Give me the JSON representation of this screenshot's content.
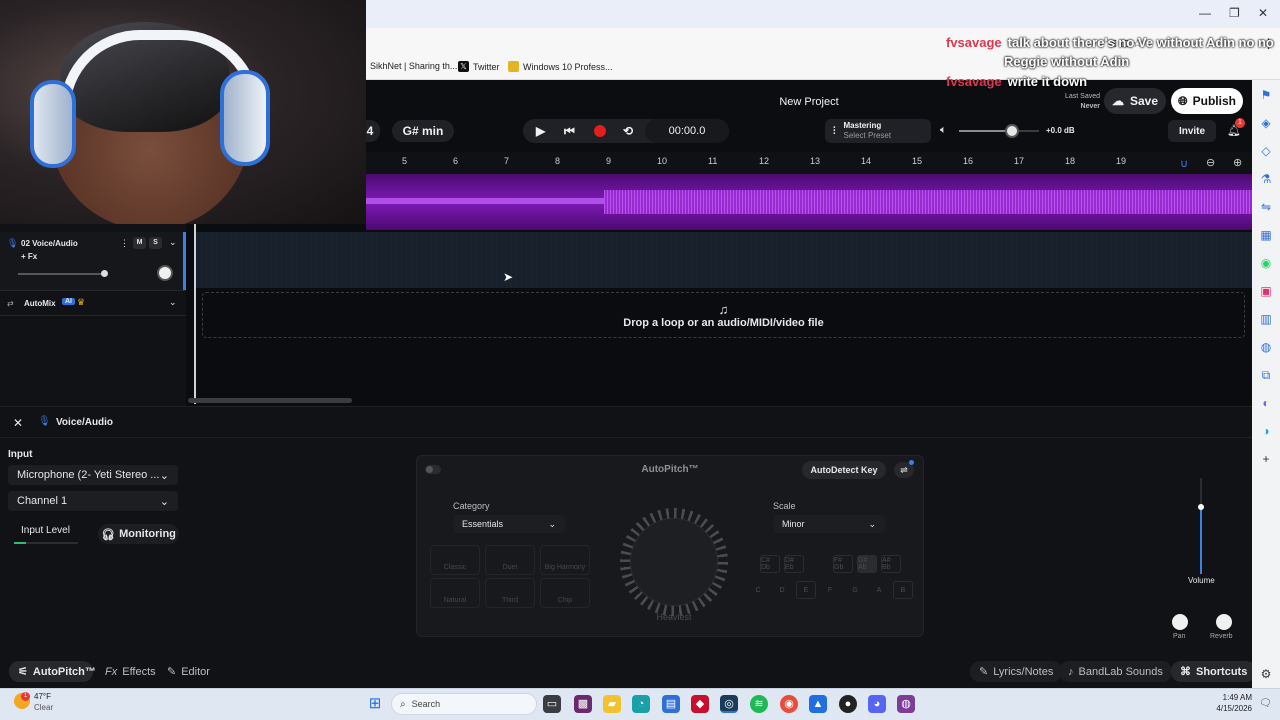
{
  "bookmarks": [
    {
      "label": "SikhNet | Sharing th..."
    },
    {
      "label": "Twitter"
    },
    {
      "label": "Windows 10 Profess..."
    }
  ],
  "chat": [
    {
      "user": "fvsavage",
      "message": "talk about there's no Ve without Adin no no"
    },
    {
      "user": "",
      "message": "Reggie without Adin"
    },
    {
      "user": "fvsavage",
      "message": "write it down"
    }
  ],
  "header": {
    "project_title": "New Project",
    "bar_num": "4",
    "key": "G# min",
    "time": "00:00.0",
    "mastering_title": "Mastering",
    "mastering_sub": "Select Preset",
    "volume_db": "+0.0 dB",
    "last_saved_label": "Last Saved",
    "last_saved_value": "Never",
    "save_label": "Save",
    "publish_label": "Publish",
    "invite_label": "Invite",
    "notif_count": "1",
    "volume_level": 0.66
  },
  "ruler": [
    "5",
    "6",
    "7",
    "8",
    "9",
    "10",
    "11",
    "12",
    "13",
    "14",
    "15",
    "16",
    "17",
    "18",
    "19"
  ],
  "tracks": {
    "track2_name": "02  Voice/Audio",
    "track2_fx": "+ Fx",
    "mute": "M",
    "solo": "S",
    "automix": "AutoMix",
    "ai_badge": "AI"
  },
  "dropzone": {
    "text": "Drop a loop or an audio/MIDI/video file"
  },
  "panel": {
    "title": "Voice/Audio",
    "input_label": "Input",
    "input_device": "Microphone (2- Yeti Stereo ...",
    "channel": "Channel 1",
    "input_level": "Input Level",
    "monitoring": "Monitoring"
  },
  "autopitch": {
    "title": "AutoPitch™",
    "autodetect": "AutoDetect Key",
    "category_label": "Category",
    "category_value": "Essentials",
    "scale_label": "Scale",
    "scale_value": "Minor",
    "knob_label": "Heaviest",
    "presets": [
      "Classic",
      "Duet",
      "Big Harmony",
      "Natural",
      "Third",
      "Chip"
    ],
    "sharps": [
      "C#\nDb",
      "D#\nEb",
      "F#\nGb",
      "G#\nAb",
      "A#\nBb"
    ],
    "naturals": [
      "C",
      "D",
      "E",
      "F",
      "G",
      "A",
      "B"
    ]
  },
  "mixer": {
    "volume_label": "Volume",
    "pan_label": "Pan",
    "reverb_label": "Reverb"
  },
  "footer": {
    "autopitch_tab": "AutoPitch™",
    "effects_tab": "Effects",
    "editor_tab": "Editor",
    "lyrics": "Lyrics/Notes",
    "sounds": "BandLab Sounds",
    "shortcuts": "Shortcuts"
  },
  "taskbar": {
    "weather_temp": "47°F",
    "weather_desc": "Clear",
    "search_placeholder": "Search",
    "time": "1:49 AM",
    "date": "4/15/2026"
  },
  "colors": {
    "accent_purple": "#8a1fc4",
    "record_red": "#e0201c",
    "chat_user": "#e0364e"
  }
}
